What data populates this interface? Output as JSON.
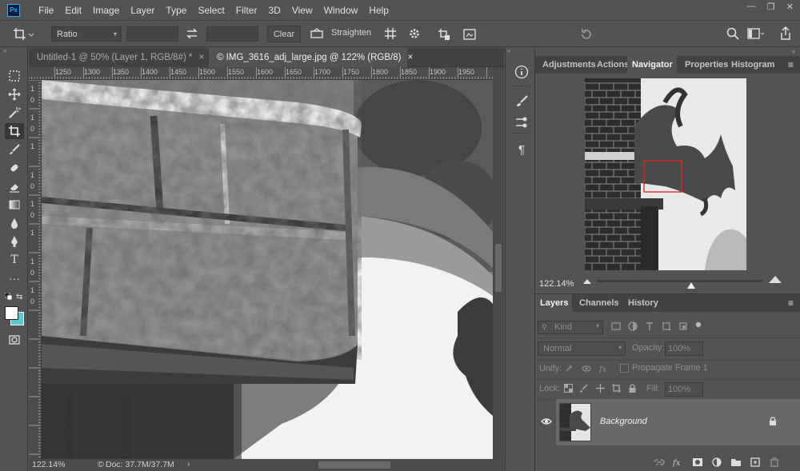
{
  "app": {
    "logo_text": "Ps",
    "menus": [
      "File",
      "Edit",
      "Image",
      "Layer",
      "Type",
      "Select",
      "Filter",
      "3D",
      "View",
      "Window",
      "Help"
    ],
    "window_controls": [
      "—",
      "❐",
      "✕"
    ]
  },
  "options_bar": {
    "ratio_label": "Ratio",
    "clear_label": "Clear",
    "straighten_label": "Straighten"
  },
  "document_tabs": [
    {
      "label": "Untitled-1 @ 50% (Layer 1, RGB/8#) *",
      "active": false,
      "close": "×"
    },
    {
      "label": "© IMG_3616_adj_large.jpg @ 122% (RGB/8)",
      "active": true,
      "close": "×"
    }
  ],
  "rulers": {
    "horizontal": [
      "1250",
      "1300",
      "1350",
      "1400",
      "1450",
      "1500",
      "1550",
      "1600",
      "1650",
      "1700",
      "1750",
      "1800",
      "1850",
      "1900",
      "1950"
    ],
    "vertical": [
      "1",
      "0",
      "1",
      "0",
      "1",
      "1",
      "0",
      "1",
      "0",
      "1",
      "1",
      "0",
      "1",
      "0"
    ]
  },
  "status_bar": {
    "zoom": "122.14%",
    "doc_info": "Doc: 37.7M/37.7M",
    "arrow": "›"
  },
  "panels": {
    "top_tabs": [
      "Adjustments",
      "Actions",
      "Navigator",
      "Properties",
      "Histogram"
    ],
    "top_active": "Navigator",
    "navigator": {
      "zoom": "122.14%",
      "zoom_level": 0.57
    },
    "layers_tabs": [
      "Layers",
      "Channels",
      "History"
    ],
    "layers_active": "Layers",
    "kind_label": "Kind",
    "blend_mode": "Normal",
    "opacity_label": "Opacity:",
    "opacity_value": "100%",
    "unify_label": "Unify:",
    "propagate_label": "Propagate Frame 1",
    "lock_label": "Lock:",
    "fill_label": "Fill:",
    "fill_value": "100%",
    "layer_name": "Background"
  },
  "colors": {
    "accent": "#31a8ff",
    "nav_box": "#e02020",
    "swatch_bg": "#5cc8d0"
  }
}
